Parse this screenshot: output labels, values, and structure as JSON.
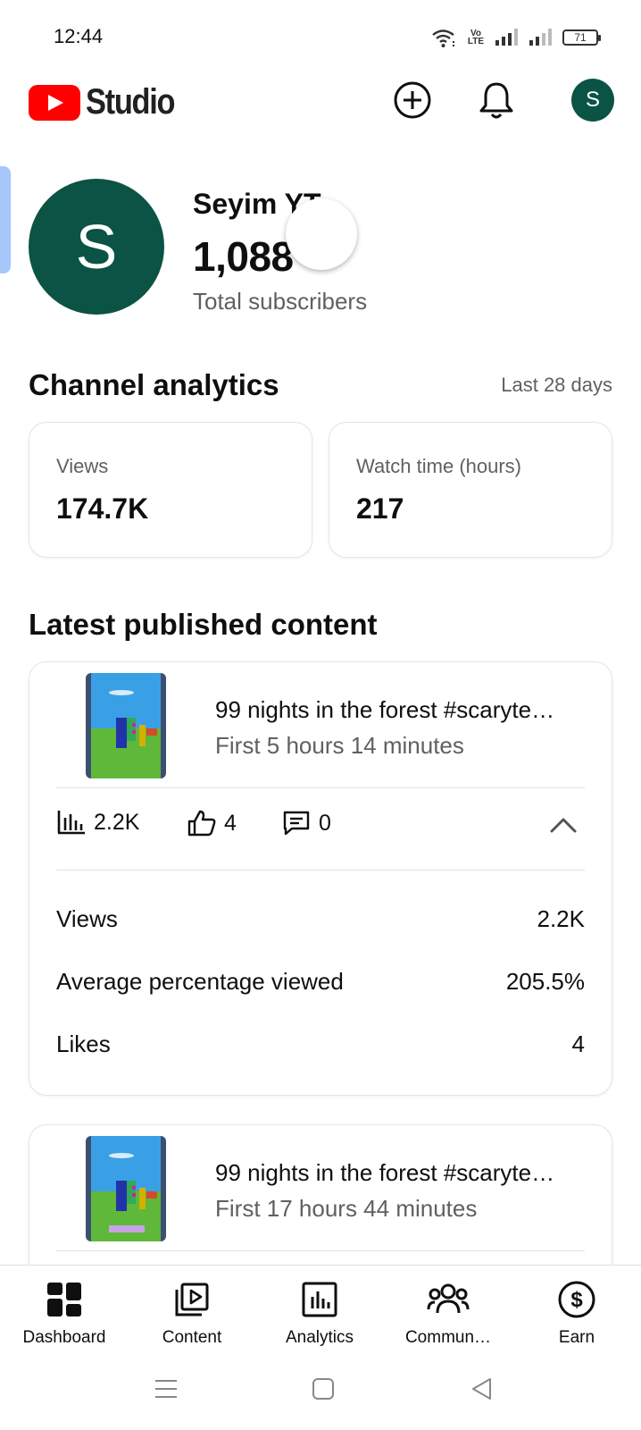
{
  "status_bar": {
    "time": "12:44",
    "volte_label": "Vo LTE",
    "battery": "71"
  },
  "header": {
    "logo_text": "Studio",
    "avatar_letter": "S"
  },
  "channel": {
    "avatar_letter": "S",
    "name": "Seyim YT",
    "subscribers": "1,088",
    "subscribers_label": "Total subscribers"
  },
  "analytics": {
    "title": "Channel analytics",
    "period": "Last 28 days",
    "cards": [
      {
        "label": "Views",
        "value": "174.7K"
      },
      {
        "label": "Watch time (hours)",
        "value": "217"
      }
    ]
  },
  "latest": {
    "title": "Latest published content",
    "items": [
      {
        "title": "99 nights in the forest #scaryte…",
        "subtitle": "First 5 hours 14 minutes",
        "views": "2.2K",
        "likes": "4",
        "comments": "0",
        "details": [
          {
            "label": "Views",
            "value": "2.2K"
          },
          {
            "label": "Average percentage viewed",
            "value": "205.5%"
          },
          {
            "label": "Likes",
            "value": "4"
          }
        ]
      },
      {
        "title": "99 nights in the forest #scaryte…",
        "subtitle": "First 17 hours 44 minutes"
      }
    ]
  },
  "bottom_nav": [
    {
      "label": "Dashboard",
      "icon": "dashboard-icon"
    },
    {
      "label": "Content",
      "icon": "content-icon"
    },
    {
      "label": "Analytics",
      "icon": "analytics-icon"
    },
    {
      "label": "Commun…",
      "icon": "community-icon"
    },
    {
      "label": "Earn",
      "icon": "earn-icon"
    }
  ]
}
